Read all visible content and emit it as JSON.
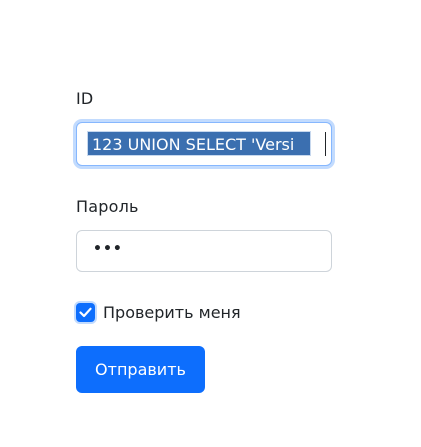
{
  "form": {
    "id_label": "ID",
    "id_value": "123 UNION SELECT 'Versi",
    "password_label": "Пароль",
    "password_masked": "•••",
    "remember_label": "Проверить меня",
    "remember_checked": true,
    "submit_label": "Отправить"
  },
  "colors": {
    "accent": "#0d6efd",
    "selection": "#3b6fb0",
    "text": "#212529",
    "border": "#ced4da"
  }
}
